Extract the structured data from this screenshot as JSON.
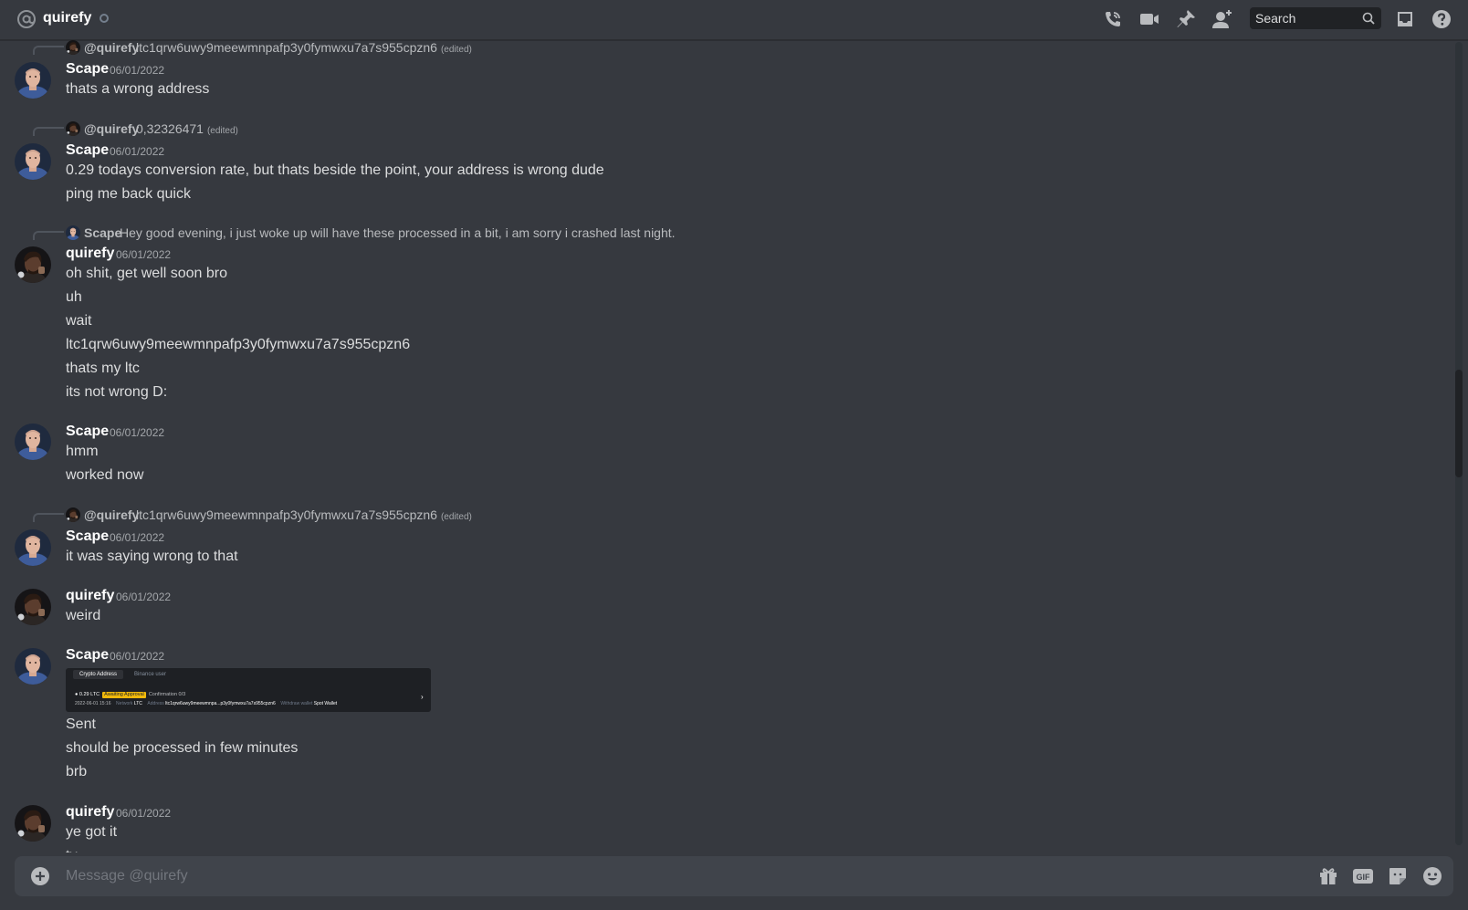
{
  "header": {
    "channel_name": "quirefy",
    "search_placeholder": "Search"
  },
  "messages": [
    {
      "reply_author": "@quirefy",
      "reply_text": "ltc1qrw6uwy9meewmnpafp3y0fymwxu7a7s955cpzn6",
      "reply_edited": "(edited)",
      "author": "Scape",
      "timestamp": "06/01/2022",
      "lines": [
        "thats a wrong address"
      ]
    },
    {
      "reply_author": "@quirefy",
      "reply_text": "0,32326471",
      "reply_edited": "(edited)",
      "author": "Scape",
      "timestamp": "06/01/2022",
      "lines": [
        "0.29 todays conversion rate, but thats beside the point, your address is wrong dude",
        "ping me back quick"
      ]
    },
    {
      "reply_author": "Scape",
      "reply_text": "Hey good evening, i just woke up will have these processed in  a bit, i am sorry i crashed last night.",
      "author": "quirefy",
      "timestamp": "06/01/2022",
      "lines": [
        "oh shit, get well soon bro",
        "uh",
        "wait",
        "ltc1qrw6uwy9meewmnpafp3y0fymwxu7a7s955cpzn6",
        "thats my ltc",
        "its not wrong D:"
      ]
    },
    {
      "author": "Scape",
      "timestamp": "06/01/2022",
      "lines": [
        "hmm",
        "worked now"
      ]
    },
    {
      "reply_author": "@quirefy",
      "reply_text": "ltc1qrw6uwy9meewmnpafp3y0fymwxu7a7s955cpzn6",
      "reply_edited": "(edited)",
      "author": "Scape",
      "timestamp": "06/01/2022",
      "lines": [
        "it was saying wrong to that"
      ]
    },
    {
      "author": "quirefy",
      "timestamp": "06/01/2022",
      "lines": [
        "weird"
      ]
    },
    {
      "author": "Scape",
      "timestamp": "06/01/2022",
      "lines": [
        "Sent",
        "should be processed in few minutes",
        "brb"
      ]
    },
    {
      "author": "quirefy",
      "timestamp": "06/01/2022",
      "lines": [
        "ye got it",
        "ty"
      ]
    }
  ],
  "attachment": {
    "tab_active": "Crypto Address",
    "tab_inactive": "Binance user",
    "amount": "0.29 LTC",
    "status_badge": "Awaiting Approval",
    "confirmation": "Confirmation 0/3",
    "date": "2022-06-01 15:16",
    "network_label": "Network",
    "network_value": "LTC",
    "address_label": "Address",
    "address_value": "ltc1qrw6uwy9meewmnpa...p3y0fymwxu7a7s955cpzn6",
    "wallet_label": "Withdraw wallet",
    "wallet_value": "Spot Wallet"
  },
  "composer": {
    "placeholder": "Message @quirefy"
  },
  "icons": [
    "at-icon",
    "call-icon",
    "video-icon",
    "pin-icon",
    "add-friend-icon",
    "search-icon",
    "inbox-icon",
    "help-icon",
    "plus-circle-icon",
    "gift-icon",
    "gif-icon",
    "sticker-icon",
    "emoji-icon"
  ],
  "colors": {
    "background": "#36393f",
    "header_text": "#ffffff",
    "muted": "#a3a6aa",
    "composer": "#40444b",
    "search": "#202225"
  }
}
